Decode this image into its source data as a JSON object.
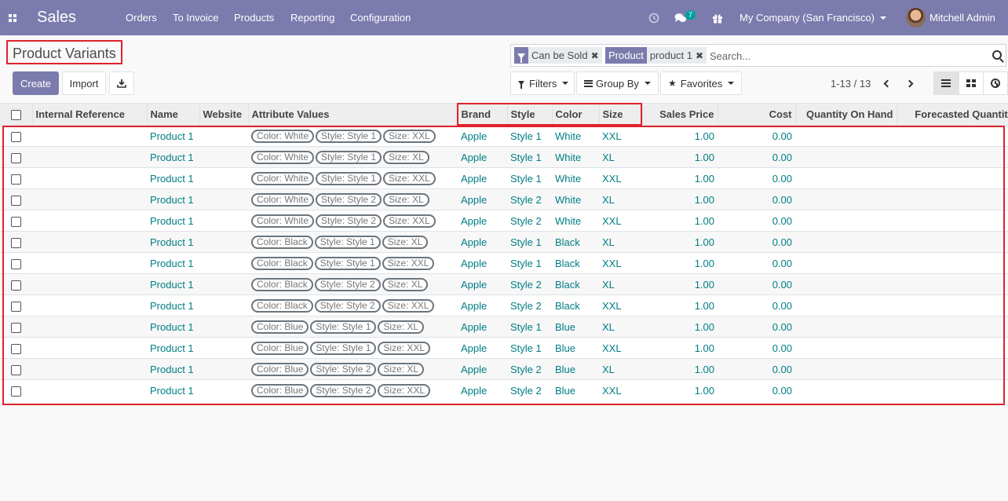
{
  "navbar": {
    "app_title": "Sales",
    "menu": [
      "Orders",
      "To Invoice",
      "Products",
      "Reporting",
      "Configuration"
    ],
    "chat_badge": "7",
    "company": "My Company (San Francisco)",
    "user": "Mitchell Admin",
    "bg_color": "#7c7bad"
  },
  "breadcrumb": "Product Variants",
  "buttons": {
    "create": "Create",
    "import": "Import"
  },
  "search": {
    "facets": [
      {
        "label": "",
        "value": "Can be Sold"
      },
      {
        "label": "Product",
        "value": "product 1"
      }
    ],
    "placeholder": "Search..."
  },
  "dropdowns": {
    "filters": "Filters",
    "group_by": "Group By",
    "favorites": "Favorites"
  },
  "pager": "1-13 / 13",
  "columns": [
    "Internal Reference",
    "Name",
    "Website",
    "Attribute Values",
    "Brand",
    "Style",
    "Color",
    "Size",
    "Sales Price",
    "Cost",
    "Quantity On Hand",
    "Forecasted Quantity"
  ],
  "rows": [
    {
      "name": "Product 1",
      "tags": [
        "Color: White",
        "Style: Style 1",
        "Size: XXL"
      ],
      "brand": "Apple",
      "style": "Style 1",
      "color": "White",
      "size": "XXL",
      "price": "1.00",
      "cost": "0.00"
    },
    {
      "name": "Product 1",
      "tags": [
        "Color: White",
        "Style: Style 1",
        "Size: XL"
      ],
      "brand": "Apple",
      "style": "Style 1",
      "color": "White",
      "size": "XL",
      "price": "1.00",
      "cost": "0.00"
    },
    {
      "name": "Product 1",
      "tags": [
        "Color: White",
        "Style: Style 1",
        "Size: XXL"
      ],
      "brand": "Apple",
      "style": "Style 1",
      "color": "White",
      "size": "XXL",
      "price": "1.00",
      "cost": "0.00"
    },
    {
      "name": "Product 1",
      "tags": [
        "Color: White",
        "Style: Style 2",
        "Size: XL"
      ],
      "brand": "Apple",
      "style": "Style 2",
      "color": "White",
      "size": "XL",
      "price": "1.00",
      "cost": "0.00"
    },
    {
      "name": "Product 1",
      "tags": [
        "Color: White",
        "Style: Style 2",
        "Size: XXL"
      ],
      "brand": "Apple",
      "style": "Style 2",
      "color": "White",
      "size": "XXL",
      "price": "1.00",
      "cost": "0.00"
    },
    {
      "name": "Product 1",
      "tags": [
        "Color: Black",
        "Style: Style 1",
        "Size: XL"
      ],
      "brand": "Apple",
      "style": "Style 1",
      "color": "Black",
      "size": "XL",
      "price": "1.00",
      "cost": "0.00"
    },
    {
      "name": "Product 1",
      "tags": [
        "Color: Black",
        "Style: Style 1",
        "Size: XXL"
      ],
      "brand": "Apple",
      "style": "Style 1",
      "color": "Black",
      "size": "XXL",
      "price": "1.00",
      "cost": "0.00"
    },
    {
      "name": "Product 1",
      "tags": [
        "Color: Black",
        "Style: Style 2",
        "Size: XL"
      ],
      "brand": "Apple",
      "style": "Style 2",
      "color": "Black",
      "size": "XL",
      "price": "1.00",
      "cost": "0.00"
    },
    {
      "name": "Product 1",
      "tags": [
        "Color: Black",
        "Style: Style 2",
        "Size: XXL"
      ],
      "brand": "Apple",
      "style": "Style 2",
      "color": "Black",
      "size": "XXL",
      "price": "1.00",
      "cost": "0.00"
    },
    {
      "name": "Product 1",
      "tags": [
        "Color: Blue",
        "Style: Style 1",
        "Size: XL"
      ],
      "brand": "Apple",
      "style": "Style 1",
      "color": "Blue",
      "size": "XL",
      "price": "1.00",
      "cost": "0.00"
    },
    {
      "name": "Product 1",
      "tags": [
        "Color: Blue",
        "Style: Style 1",
        "Size: XXL"
      ],
      "brand": "Apple",
      "style": "Style 1",
      "color": "Blue",
      "size": "XXL",
      "price": "1.00",
      "cost": "0.00"
    },
    {
      "name": "Product 1",
      "tags": [
        "Color: Blue",
        "Style: Style 2",
        "Size: XL"
      ],
      "brand": "Apple",
      "style": "Style 2",
      "color": "Blue",
      "size": "XL",
      "price": "1.00",
      "cost": "0.00"
    },
    {
      "name": "Product 1",
      "tags": [
        "Color: Blue",
        "Style: Style 2",
        "Size: XXL"
      ],
      "brand": "Apple",
      "style": "Style 2",
      "color": "Blue",
      "size": "XXL",
      "price": "1.00",
      "cost": "0.00"
    }
  ],
  "colors": {
    "link": "#017e84",
    "highlight": "#e0222b",
    "primary": "#7c7bad"
  }
}
